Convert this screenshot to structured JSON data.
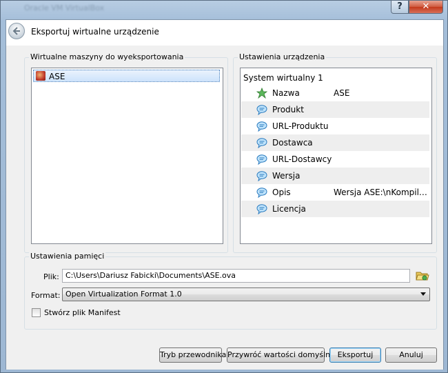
{
  "window": {
    "ghost_title": "Oracle VM VirtualBox",
    "help_label": "?",
    "close_label": "✕"
  },
  "header": {
    "title": "Eksportuj wirtualne urządzenie"
  },
  "vm_group": {
    "title": "Wirtualne maszyny do wyeksportowania",
    "items": [
      {
        "label": "ASE",
        "selected": true
      }
    ]
  },
  "settings_group": {
    "title": "Ustawienia urządzenia",
    "system_label": "System wirtualny 1",
    "properties": [
      {
        "name": "Nazwa",
        "value": "ASE",
        "icon": "name-star-icon"
      },
      {
        "name": "Produkt",
        "value": "",
        "icon": "description-bubble-icon"
      },
      {
        "name": "URL-Produktu",
        "value": "",
        "icon": "description-bubble-icon"
      },
      {
        "name": "Dostawca",
        "value": "",
        "icon": "description-bubble-icon"
      },
      {
        "name": "URL-Dostawcy",
        "value": "",
        "icon": "description-bubble-icon"
      },
      {
        "name": "Wersja",
        "value": "",
        "icon": "description-bubble-icon"
      },
      {
        "name": "Opis",
        "value": "Wersja ASE:\\nKompilacj...",
        "icon": "description-bubble-icon"
      },
      {
        "name": "Licencja",
        "value": "",
        "icon": "description-bubble-icon"
      }
    ]
  },
  "storage_group": {
    "title": "Ustawienia pamięci",
    "file_label": "Plik:",
    "file_value": "C:\\Users\\Dariusz Fabicki\\Documents\\ASE.ova",
    "format_label": "Format:",
    "format_value": "Open Virtualization Format 1.0",
    "manifest_label": "Stwórz plik Manifest",
    "manifest_checked": false
  },
  "buttons": {
    "guided_mode": "Tryb przewodnika",
    "restore_defaults": "Przywróć wartości domyślne",
    "export": "Eksportuj",
    "cancel": "Anuluj"
  }
}
